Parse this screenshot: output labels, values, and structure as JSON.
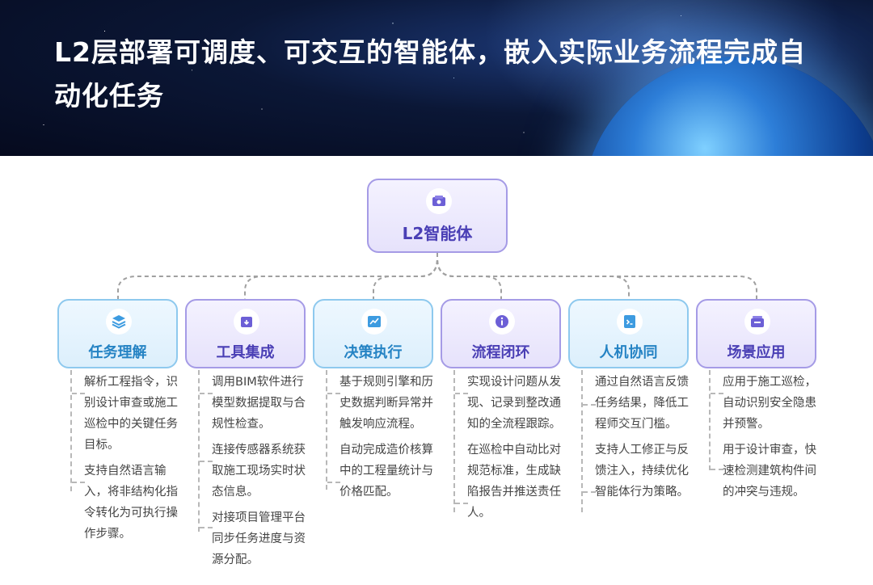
{
  "title": "L2层部署可调度、可交互的智能体，嵌入实际业务流程完成自动化任务",
  "root": {
    "label": "L2智能体",
    "icon": "agent-box-icon"
  },
  "nodes": [
    {
      "label": "任务理解",
      "icon": "layers-icon",
      "color": "#2583c4",
      "desc": [
        "解析工程指令，识别设计审查或施工巡检中的关键任务目标。",
        "支持自然语言输入，将非结构化指令转化为可执行操作步骤。"
      ]
    },
    {
      "label": "工具集成",
      "icon": "archive-box-icon",
      "color": "#4a3fb5",
      "desc": [
        "调用BIM软件进行模型数据提取与合规性检查。",
        "连接传感器系统获取施工现场实时状态信息。",
        "对接项目管理平台同步任务进度与资源分配。"
      ]
    },
    {
      "label": "决策执行",
      "icon": "trend-chart-icon",
      "color": "#2583c4",
      "desc": [
        "基于规则引擎和历史数据判断异常并触发响应流程。",
        "自动完成造价核算中的工程量统计与价格匹配。"
      ]
    },
    {
      "label": "流程闭环",
      "icon": "info-circle-icon",
      "color": "#4a3fb5",
      "desc": [
        "实现设计问题从发现、记录到整改通知的全流程跟踪。",
        "在巡检中自动比对规范标准，生成缺陷报告并推送责任人。"
      ]
    },
    {
      "label": "人机协同",
      "icon": "terminal-icon",
      "color": "#2583c4",
      "desc": [
        "通过自然语言反馈任务结果，降低工程师交互门槛。",
        "支持人工修正与反馈注入，持续优化智能体行为策略。"
      ]
    },
    {
      "label": "场景应用",
      "icon": "basket-icon",
      "color": "#4a3fb5",
      "desc": [
        "应用于施工巡检，自动识别安全隐患并预警。",
        "用于设计审查，快速检测建筑构件间的冲突与违规。"
      ]
    }
  ]
}
